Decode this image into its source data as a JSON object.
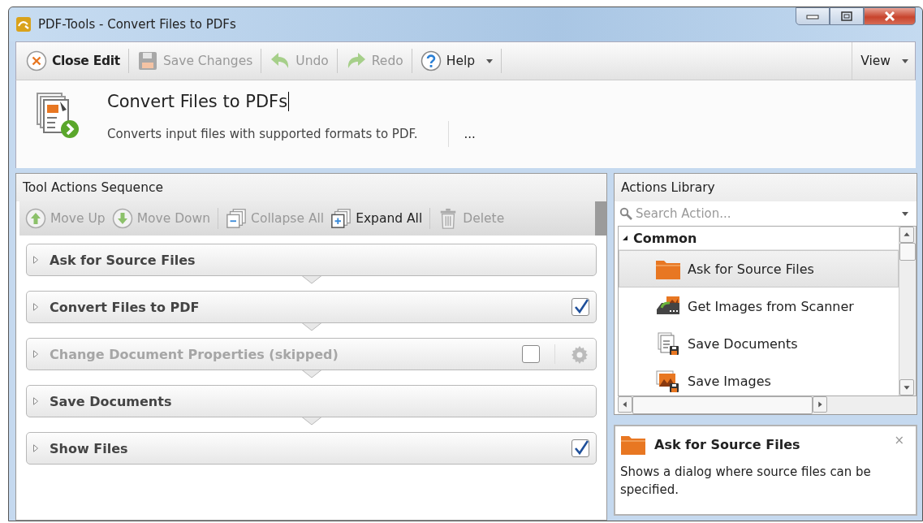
{
  "window": {
    "title": "PDF-Tools - Convert Files to PDFs"
  },
  "toolbar": {
    "buttons": [
      {
        "label": "Close Edit",
        "kind": "close",
        "disabled": false
      },
      {
        "label": "Save Changes",
        "kind": "save",
        "disabled": true
      },
      {
        "label": "Undo",
        "kind": "undo",
        "disabled": true
      },
      {
        "label": "Redo",
        "kind": "redo",
        "disabled": true
      },
      {
        "label": "Help",
        "kind": "help",
        "disabled": false
      }
    ],
    "view": "View"
  },
  "tool": {
    "name": "Convert Files to PDFs",
    "description": "Converts input files with supported formats to PDF.",
    "more": "..."
  },
  "sequence": {
    "title": "Tool Actions Sequence",
    "buttons": [
      {
        "label": "Move Up",
        "kind": "up",
        "disabled": true
      },
      {
        "label": "Move Down",
        "kind": "down",
        "disabled": true
      },
      {
        "label": "Collapse All",
        "kind": "collapse",
        "disabled": true
      },
      {
        "label": "Expand All",
        "kind": "expand",
        "disabled": false
      },
      {
        "label": "Delete",
        "kind": "delete",
        "disabled": true
      }
    ],
    "actions": [
      {
        "label": "Ask for Source Files",
        "kind": "plain",
        "skipped": false
      },
      {
        "label": "Convert Files to PDF",
        "kind": "toggle",
        "skipped": false,
        "checked": true
      },
      {
        "label": "Change Document Properties (skipped)",
        "kind": "settings",
        "skipped": true,
        "checked": false
      },
      {
        "label": "Save Documents",
        "kind": "plain",
        "skipped": false
      },
      {
        "label": "Show Files",
        "kind": "toggle",
        "skipped": false,
        "checked": true
      }
    ]
  },
  "library": {
    "title": "Actions Library",
    "search": {
      "placeholder": "Search Action..."
    },
    "category": {
      "label": "Common",
      "expanded": true,
      "items": [
        {
          "label": "Ask for Source Files",
          "kind": "folder",
          "selected": true
        },
        {
          "label": "Get Images from Scanner",
          "kind": "scanner",
          "selected": false
        },
        {
          "label": "Save Documents",
          "kind": "save-docs",
          "selected": false
        },
        {
          "label": "Save Images",
          "kind": "save-images",
          "selected": false
        }
      ]
    }
  },
  "info": {
    "title": "Ask for Source Files",
    "description": "Shows a dialog where source files can be specified.",
    "close": "×"
  }
}
